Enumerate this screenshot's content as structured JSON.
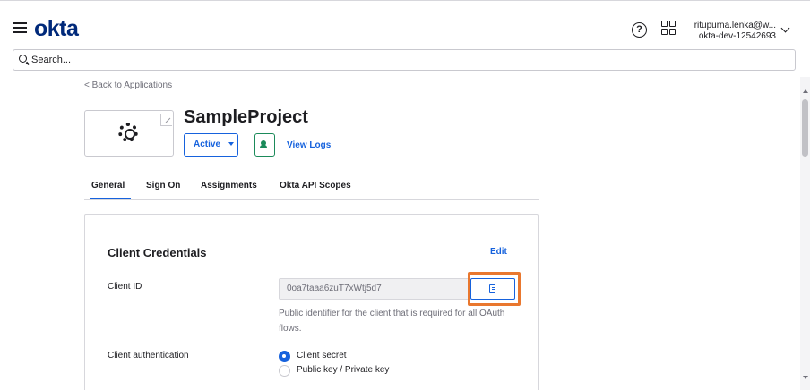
{
  "header": {
    "logo": "okta",
    "help_icon": "question-circle-icon",
    "apps_icon": "app-grid-icon",
    "user_email": "ritupurna.lenka@w...",
    "user_org": "okta-dev-12542693"
  },
  "search": {
    "placeholder": "Search..."
  },
  "breadcrumb": {
    "back_label": "< Back to Applications"
  },
  "app": {
    "icon": "gear-icon",
    "title": "SampleProject",
    "status_label": "Active",
    "push_icon": "person-push-icon",
    "view_logs": "View Logs"
  },
  "tabs": [
    {
      "label": "General",
      "active": true
    },
    {
      "label": "Sign On",
      "active": false
    },
    {
      "label": "Assignments",
      "active": false
    },
    {
      "label": "Okta API Scopes",
      "active": false
    }
  ],
  "credentials": {
    "title": "Client Credentials",
    "edit_label": "Edit",
    "client_id_label": "Client ID",
    "client_id_value": "0oa7taaa6zuT7xWtj5d7",
    "client_id_help": "Public identifier for the client that is required for all OAuth flows.",
    "copy_icon": "clipboard-copy-icon",
    "auth_label": "Client authentication",
    "auth_options": [
      {
        "label": "Client secret",
        "selected": true
      },
      {
        "label": "Public key / Private key",
        "selected": false
      }
    ]
  },
  "colors": {
    "brand": "#00297a",
    "link": "#1662dd",
    "highlight": "#e9772e",
    "success": "#1b8a5a"
  }
}
